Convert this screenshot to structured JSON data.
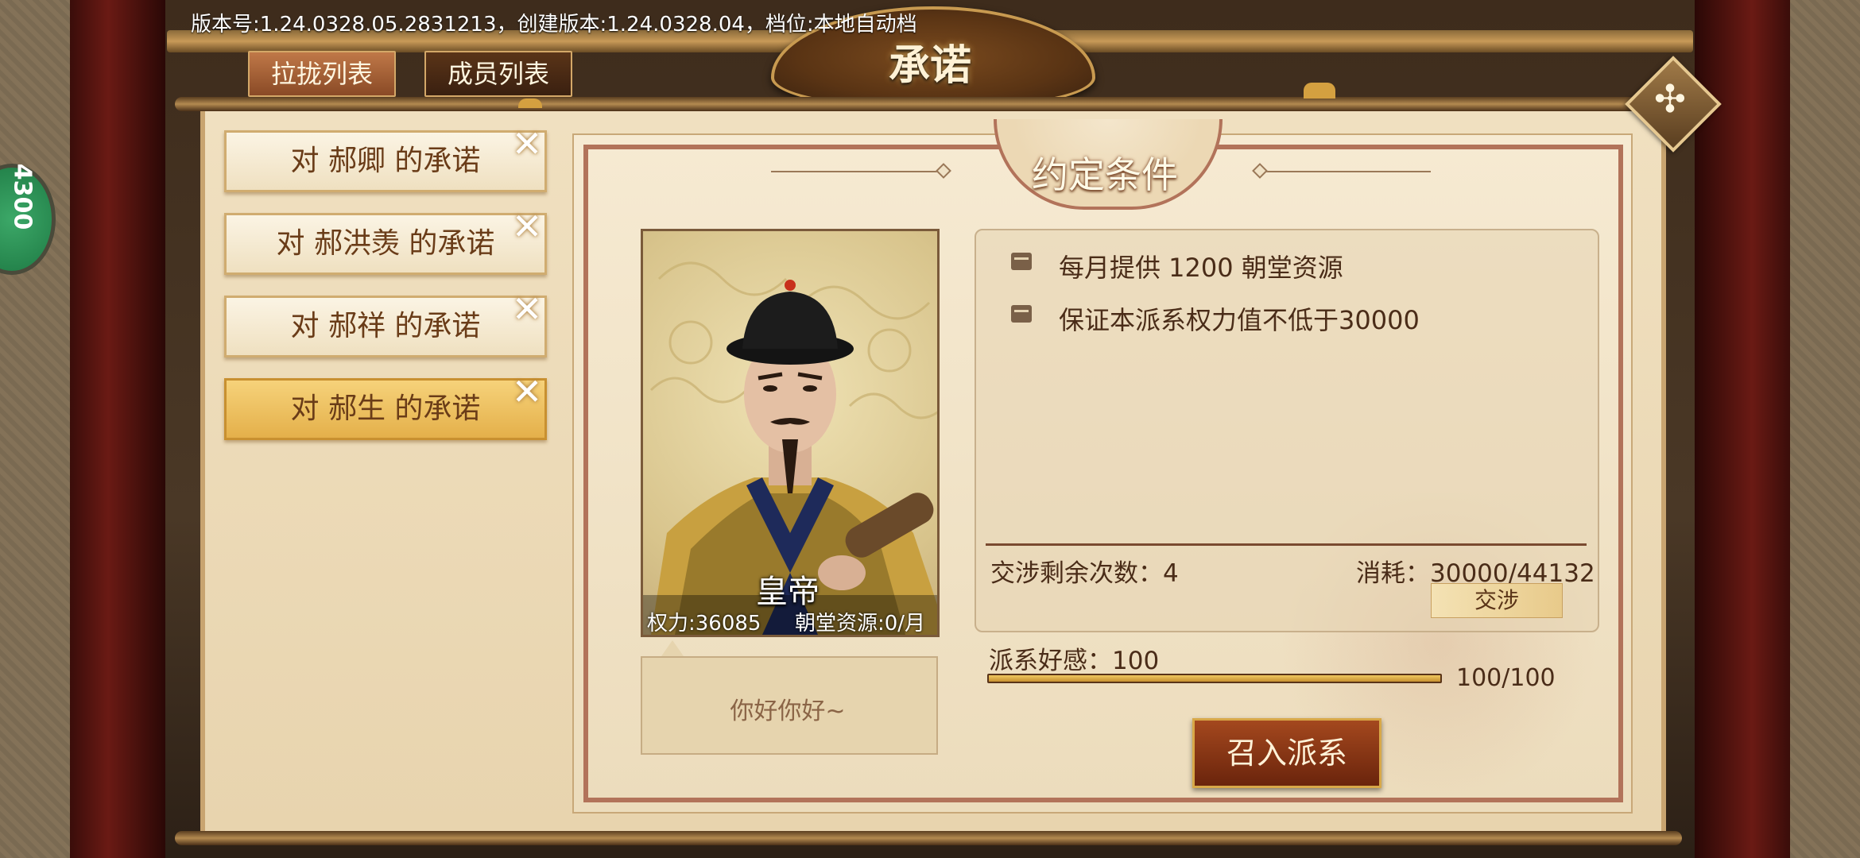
{
  "version_text": "版本号:1.24.0328.05.2831213，创建版本:1.24.0328.04，档位:本地自动档",
  "page_title": "承诺",
  "tabs": [
    {
      "label": "拉拢列表",
      "active": true
    },
    {
      "label": "成员列表",
      "active": false
    }
  ],
  "promises": [
    {
      "label": "对 郝卿 的承诺",
      "active": false
    },
    {
      "label": "对 郝洪羡 的承诺",
      "active": false
    },
    {
      "label": "对 郝祥 的承诺",
      "active": false
    },
    {
      "label": "对 郝生 的承诺",
      "active": true
    }
  ],
  "section_title": "约定条件",
  "character": {
    "name": "皇帝",
    "power": "权力:36085",
    "resource": "朝堂资源:0/月",
    "speech": "你好你好~"
  },
  "conditions": [
    "每月提供 1200 朝堂资源",
    "保证本派系权力值不低于30000"
  ],
  "negotiation": {
    "remaining": "交涉剩余次数：4",
    "cost": "消耗：30000/44132",
    "button": "交涉"
  },
  "affinity": {
    "label": "派系好感：100",
    "value_text": "100/100",
    "fraction": 1.0
  },
  "recruit_button": "召入派系",
  "side_badge": "4300",
  "colors": {
    "accent": "#b2735a",
    "active_item": "#e4b04a",
    "recruit": "#8a3414"
  }
}
